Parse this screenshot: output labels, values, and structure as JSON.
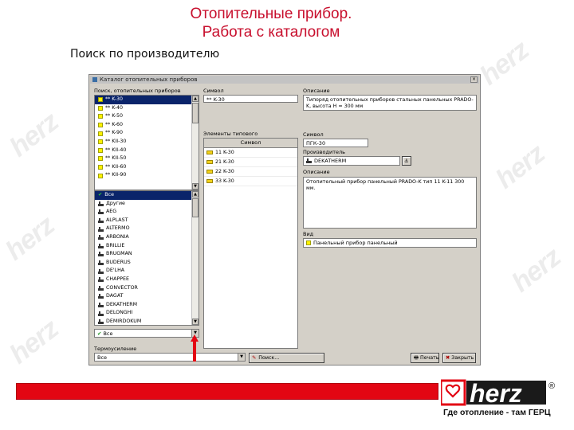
{
  "slide": {
    "title_line1": "Отопительные прибор.",
    "title_line2": "Работа с каталогом",
    "subtitle": "Поиск по производителю",
    "tagline": "Где отопление - там ГЕРЦ",
    "logo_text": "herz",
    "logo_mark": "®",
    "watermark": "herz"
  },
  "window": {
    "title": "Каталог отопительных приборов",
    "close_glyph": "×",
    "search_type_label": "Поиск, отопительных приборов",
    "types_list": [
      {
        "label": "** K-30",
        "selected": true
      },
      {
        "label": "** K-40",
        "selected": false
      },
      {
        "label": "** K-50",
        "selected": false
      },
      {
        "label": "** K-60",
        "selected": false
      },
      {
        "label": "** K-90",
        "selected": false
      },
      {
        "label": "** KII-30",
        "selected": false
      },
      {
        "label": "** KII-40",
        "selected": false
      },
      {
        "label": "** KII-50",
        "selected": false
      },
      {
        "label": "** KII-60",
        "selected": false
      },
      {
        "label": "** KII-90",
        "selected": false
      }
    ],
    "manufacturer_list": [
      {
        "label": "Все",
        "selected": true
      },
      {
        "label": "Другие",
        "selected": false
      },
      {
        "label": "AEG",
        "selected": false
      },
      {
        "label": "ALPLAST",
        "selected": false
      },
      {
        "label": "ALTERMO",
        "selected": false
      },
      {
        "label": "ARBONIA",
        "selected": false
      },
      {
        "label": "BRILLIE",
        "selected": false
      },
      {
        "label": "BRUGMAN",
        "selected": false
      },
      {
        "label": "BUDERUS",
        "selected": false
      },
      {
        "label": "DE'LHA",
        "selected": false
      },
      {
        "label": "CHAPPEE",
        "selected": false
      },
      {
        "label": "CONVECTOR",
        "selected": false
      },
      {
        "label": "DAGAT",
        "selected": false
      },
      {
        "label": "DEKATHERM",
        "selected": false
      },
      {
        "label": "DELONGHI",
        "selected": false
      },
      {
        "label": "DEMIRDOKUM",
        "selected": false
      }
    ],
    "bottom_combo_value": "Все",
    "comfort_label": "Термоусиление",
    "comfort_value": "Все",
    "search_button": "Поиск...",
    "print_button": "Печать",
    "close_button": "Закрыть",
    "symbol_label": "Символ",
    "symbol_value": "** K-30",
    "desc_label": "Описание",
    "desc_value": "Типоряд отопительных приборов стальных панельных PRADO-K, высота H = 300 мм",
    "elements_label": "Элементы типового",
    "elements_header": "Символ",
    "elements": [
      "11  K-30",
      "21  K-30",
      "22  K-30",
      "33  K-30"
    ],
    "model_label": "Символ",
    "model_value": "ПГК-30",
    "manufacturer_label": "Производитель",
    "manufacturer_value": "DEKATHERM",
    "note_label": "Описание",
    "note_value": "Отопительный прибор панельный PRADO-K тип 11 K-11 300 мм.",
    "kind_label": "Вид",
    "kind_value": "Панельный прибор панельный"
  },
  "colors": {
    "brand_red": "#e30613",
    "title_red": "#c8102e",
    "selection_blue": "#0a246a",
    "window_gray": "#d4d0c8"
  }
}
